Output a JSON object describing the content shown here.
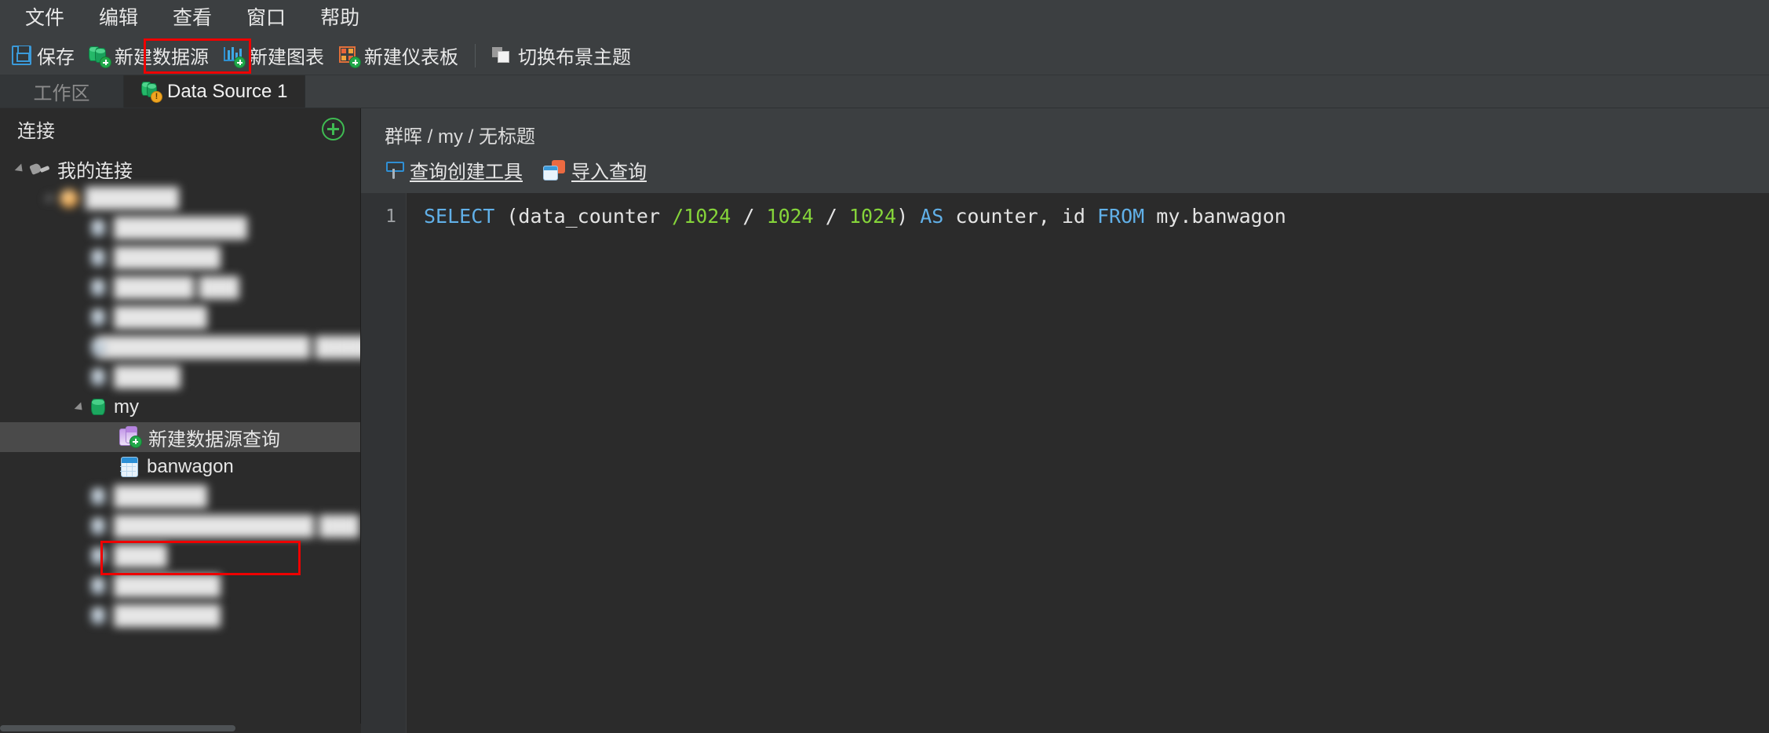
{
  "menubar": {
    "items": [
      {
        "label": "文件",
        "name": "menu-file"
      },
      {
        "label": "编辑",
        "name": "menu-edit"
      },
      {
        "label": "查看",
        "name": "menu-view"
      },
      {
        "label": "窗口",
        "name": "menu-window"
      },
      {
        "label": "帮助",
        "name": "menu-help"
      }
    ]
  },
  "toolbar": {
    "save_label": "保存",
    "new_datasource_label": "新建数据源",
    "new_chart_label": "新建图表",
    "new_dashboard_label": "新建仪表板",
    "switch_theme_label": "切换布景主题",
    "highlight_color": "#ee0000",
    "icons": {
      "save": "floppy-disk-icon",
      "new_datasource": "database-add-icon",
      "new_chart": "bar-chart-add-icon",
      "new_dashboard": "dashboard-add-icon",
      "switch_theme": "theme-windows-icon"
    }
  },
  "tabs": {
    "workspace_label": "工作区",
    "datasource_label": "Data Source 1",
    "datasource_badge": "!"
  },
  "sidebar": {
    "title": "连接",
    "add_button_icon": "plus-circle-icon",
    "tree": [
      {
        "label": "我的连接",
        "icon": "plug-icon",
        "indent": 0,
        "arrow": "open",
        "blurred": false,
        "selected": false,
        "name": "tree-item-my-connection"
      },
      {
        "label": "███████",
        "icon": "server-icon",
        "indent": 1,
        "arrow": "open",
        "blurred": true,
        "selected": false,
        "name": "tree-item-server"
      },
      {
        "label": "██████████",
        "icon": "database-icon",
        "indent": 2,
        "arrow": "none",
        "blurred": true,
        "selected": false,
        "name": "tree-item-database"
      },
      {
        "label": "████████",
        "icon": "database-icon",
        "indent": 2,
        "arrow": "none",
        "blurred": true,
        "selected": false,
        "name": "tree-item-database"
      },
      {
        "label": "██████  ███",
        "icon": "database-icon",
        "indent": 2,
        "arrow": "none",
        "blurred": true,
        "selected": false,
        "name": "tree-item-database"
      },
      {
        "label": "███████",
        "icon": "database-icon",
        "indent": 2,
        "arrow": "none",
        "blurred": true,
        "selected": false,
        "name": "tree-item-database"
      },
      {
        "label": "████████████████  ████",
        "icon": "database-icon",
        "indent": 2,
        "arrow": "none",
        "blurred": true,
        "selected": false,
        "name": "tree-item-database"
      },
      {
        "label": "█████",
        "icon": "database-icon",
        "indent": 2,
        "arrow": "none",
        "blurred": true,
        "selected": false,
        "name": "tree-item-database"
      },
      {
        "label": "my",
        "icon": "database-green-icon",
        "indent": 2,
        "arrow": "open",
        "blurred": false,
        "selected": false,
        "name": "tree-item-database-my"
      },
      {
        "label": "新建数据源查询",
        "icon": "new-query-icon",
        "indent": 3,
        "arrow": "none",
        "blurred": false,
        "selected": true,
        "name": "tree-item-new-datasource-query"
      },
      {
        "label": "banwagon",
        "icon": "table-icon",
        "indent": 3,
        "arrow": "none",
        "blurred": false,
        "selected": false,
        "name": "tree-item-table-banwagon"
      },
      {
        "label": "███████",
        "icon": "database-icon",
        "indent": 2,
        "arrow": "none",
        "blurred": true,
        "selected": false,
        "name": "tree-item-database"
      },
      {
        "label": "███████████████  ███",
        "icon": "database-icon",
        "indent": 2,
        "arrow": "none",
        "blurred": true,
        "selected": false,
        "name": "tree-item-database"
      },
      {
        "label": "████",
        "icon": "database-icon",
        "indent": 2,
        "arrow": "none",
        "blurred": true,
        "selected": false,
        "name": "tree-item-database"
      },
      {
        "label": "████████",
        "icon": "database-icon",
        "indent": 2,
        "arrow": "none",
        "blurred": true,
        "selected": false,
        "name": "tree-item-database"
      },
      {
        "label": "████████",
        "icon": "database-icon",
        "indent": 2,
        "arrow": "none",
        "blurred": true,
        "selected": false,
        "name": "tree-item-database"
      }
    ],
    "highlight_color": "#ee0000"
  },
  "main": {
    "breadcrumb": "群晖 / my / 无标题",
    "query_builder_label": "查询创建工具",
    "import_query_label": "导入查询",
    "editor": {
      "line_number": "1",
      "tokens": [
        {
          "text": "SELECT",
          "kind": "keyword"
        },
        {
          "text": " (data_counter ",
          "kind": "text"
        },
        {
          "text": "/1024",
          "kind": "number"
        },
        {
          "text": " / ",
          "kind": "text"
        },
        {
          "text": "1024",
          "kind": "number"
        },
        {
          "text": " / ",
          "kind": "text"
        },
        {
          "text": "1024",
          "kind": "number"
        },
        {
          "text": ") ",
          "kind": "text"
        },
        {
          "text": "AS",
          "kind": "keyword"
        },
        {
          "text": " counter, id ",
          "kind": "text"
        },
        {
          "text": "FROM",
          "kind": "keyword"
        },
        {
          "text": " my.banwagon",
          "kind": "text"
        }
      ],
      "colors": {
        "keyword": "#61b0e8",
        "number": "#85d43a",
        "text": "#e4e4e4",
        "background": "#2b2b2b"
      }
    }
  }
}
